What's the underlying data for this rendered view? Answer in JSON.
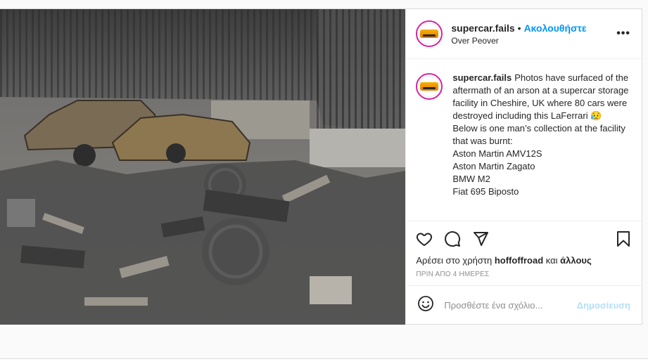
{
  "post": {
    "username": "supercar.fails",
    "dot": "•",
    "follow_label": "Ακολουθήστε",
    "location": "Over Peover",
    "more_label": "•••",
    "caption": {
      "username": "supercar.fails",
      "lines": [
        "Photos have surfaced of the aftermath of an arson at a supercar storage facility in Cheshire, UK where 80 cars were destroyed including this LaFerrari 😥",
        "Below is one man’s collection at the facility that was burnt:",
        "Aston Martin AMV12S",
        "Aston Martin Zagato",
        "BMW M2",
        "Fiat 695 Biposto"
      ]
    },
    "likes": {
      "prefix": "Αρέσει στο χρήστη",
      "user": "hoffoffroad",
      "conjunction": "και",
      "others": "άλλους"
    },
    "time": "ΠΡΙΝ ΑΠΟ 4 ΗΜΕΡΕΣ",
    "comment": {
      "placeholder": "Προσθέστε ένα σχόλιο...",
      "publish_label": "Δημοσίευση"
    },
    "icons": [
      "heart-icon",
      "comment-icon",
      "share-icon",
      "bookmark-icon",
      "emoji-icon"
    ],
    "colors": {
      "follow": "#0095f6",
      "publish_disabled": "#b2dffc",
      "muted": "#8e8e8e"
    }
  }
}
